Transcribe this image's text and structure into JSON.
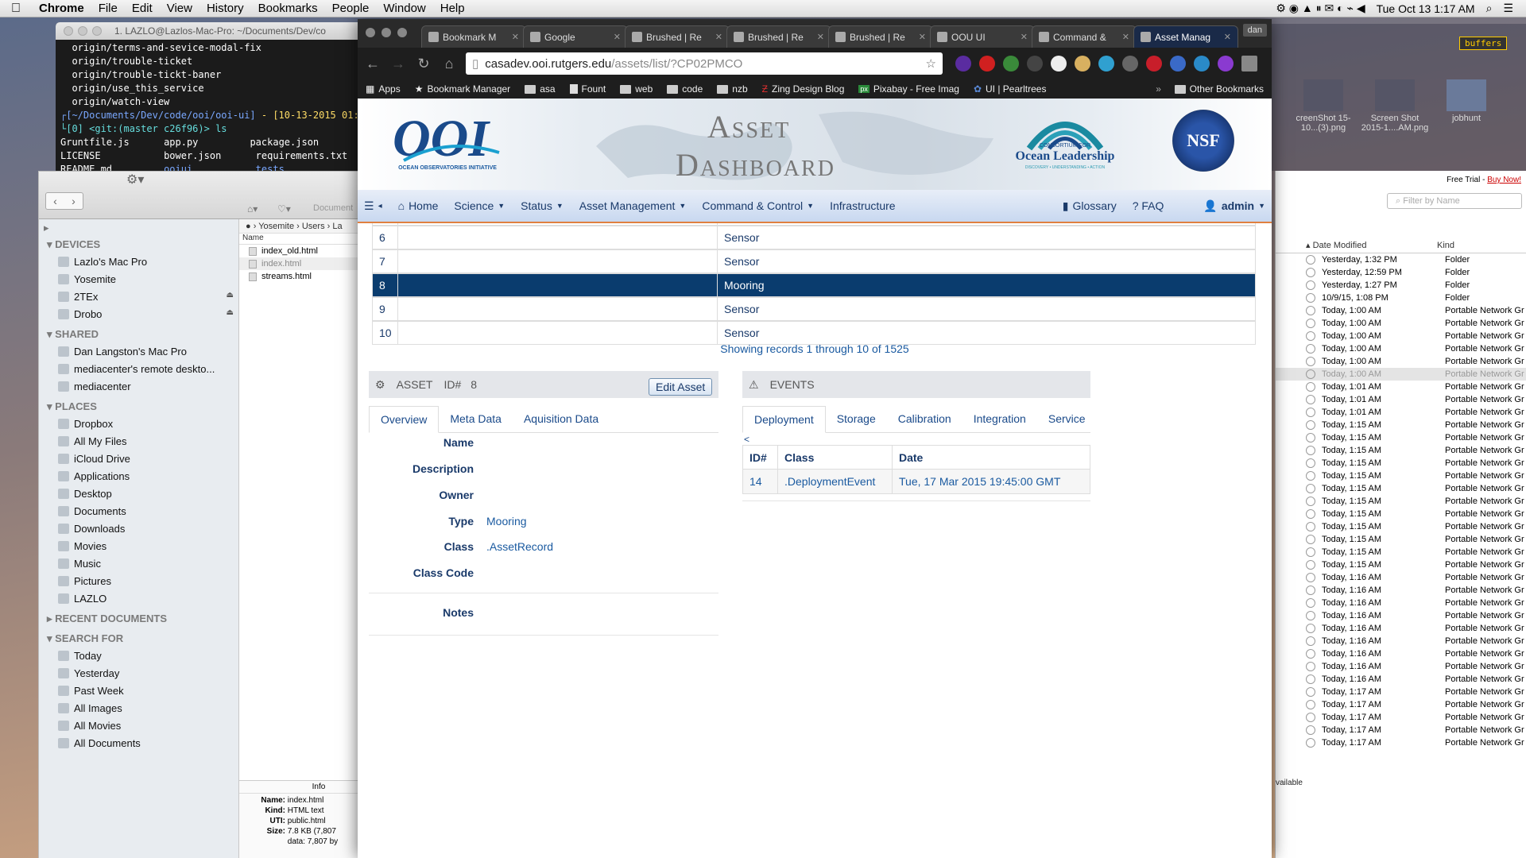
{
  "mac_menubar": {
    "apple": "",
    "items": [
      "Chrome",
      "File",
      "Edit",
      "View",
      "History",
      "Bookmarks",
      "People",
      "Window",
      "Help"
    ],
    "clock": "Tue Oct 13  1:17 AM"
  },
  "terminal": {
    "title": "1. LAZLO@Lazlos-Mac-Pro: ~/Documents/Dev/co",
    "lines": [
      "  origin/terms-and-sevice-modal-fix",
      "  origin/trouble-ticket",
      "  origin/trouble-tickt-baner",
      "  origin/use_this_service",
      "  origin/watch-view"
    ],
    "prompt_path": "┌[~/Documents/Dev/code/ooi/ooi-ui]",
    "prompt_date": " - [10-13-2015 01:1",
    "prompt2": "└[0] <git:(master c26f96)> ls",
    "ls_rows": [
      [
        "Gruntfile.js",
        "app.py",
        "package.json"
      ],
      [
        "LICENSE",
        "bower.json",
        "requirements.txt"
      ],
      [
        "README.md",
        "ooiui",
        "tests"
      ]
    ]
  },
  "finder": {
    "sections": [
      {
        "title": "DEVICES",
        "items": [
          "Lazlo's Mac Pro",
          "Yosemite",
          "2TEx",
          "Drobo"
        ]
      },
      {
        "title": "SHARED",
        "items": [
          "Dan Langston's Mac Pro",
          "mediacenter's remote deskto...",
          "mediacenter"
        ]
      },
      {
        "title": "PLACES",
        "items": [
          "Dropbox",
          "All My Files",
          "iCloud Drive",
          "Applications",
          "Desktop",
          "Documents",
          "Downloads",
          "Movies",
          "Music",
          "Pictures",
          "LAZLO"
        ]
      },
      {
        "title": "RECENT DOCUMENTS",
        "items": []
      },
      {
        "title": "SEARCH FOR",
        "items": [
          "Today",
          "Yesterday",
          "Past Week",
          "All Images",
          "All Movies",
          "All Documents"
        ]
      }
    ],
    "path": [
      "Yosemite",
      "Users",
      "La"
    ],
    "name_header": "Name",
    "files": [
      "index_old.html",
      "index.html",
      "streams.html"
    ],
    "info_header": "Info",
    "info": [
      {
        "k": "Name:",
        "v": "index.html"
      },
      {
        "k": "Kind:",
        "v": "HTML text"
      },
      {
        "k": "UTI:",
        "v": "public.html"
      },
      {
        "k": "Size:",
        "v": "7.8 KB (7,807"
      },
      {
        "k": "",
        "v": "data: 7,807 by"
      }
    ],
    "toolbar_label": "Document"
  },
  "finder2": {
    "trial": "Free Trial - ",
    "buy": "Buy Now!",
    "search_placeholder": "Filter by Name",
    "col_date": "Date Modified",
    "col_kind": "Kind",
    "rows": [
      [
        "Yesterday, 1:32 PM",
        "Folder"
      ],
      [
        "Yesterday, 12:59 PM",
        "Folder"
      ],
      [
        "Yesterday, 1:27 PM",
        "Folder"
      ],
      [
        "10/9/15, 1:08 PM",
        "Folder"
      ],
      [
        "Today, 1:00 AM",
        "Portable Network Gr"
      ],
      [
        "Today, 1:00 AM",
        "Portable Network Gr"
      ],
      [
        "Today, 1:00 AM",
        "Portable Network Gr"
      ],
      [
        "Today, 1:00 AM",
        "Portable Network Gr"
      ],
      [
        "Today, 1:00 AM",
        "Portable Network Gr"
      ],
      [
        "Today, 1:00 AM",
        "Portable Network Gr"
      ],
      [
        "Today, 1:01 AM",
        "Portable Network Gr"
      ],
      [
        "Today, 1:01 AM",
        "Portable Network Gr"
      ],
      [
        "Today, 1:01 AM",
        "Portable Network Gr"
      ],
      [
        "Today, 1:15 AM",
        "Portable Network Gr"
      ],
      [
        "Today, 1:15 AM",
        "Portable Network Gr"
      ],
      [
        "Today, 1:15 AM",
        "Portable Network Gr"
      ],
      [
        "Today, 1:15 AM",
        "Portable Network Gr"
      ],
      [
        "Today, 1:15 AM",
        "Portable Network Gr"
      ],
      [
        "Today, 1:15 AM",
        "Portable Network Gr"
      ],
      [
        "Today, 1:15 AM",
        "Portable Network Gr"
      ],
      [
        "Today, 1:15 AM",
        "Portable Network Gr"
      ],
      [
        "Today, 1:15 AM",
        "Portable Network Gr"
      ],
      [
        "Today, 1:15 AM",
        "Portable Network Gr"
      ],
      [
        "Today, 1:15 AM",
        "Portable Network Gr"
      ],
      [
        "Today, 1:15 AM",
        "Portable Network Gr"
      ],
      [
        "Today, 1:16 AM",
        "Portable Network Gr"
      ],
      [
        "Today, 1:16 AM",
        "Portable Network Gr"
      ],
      [
        "Today, 1:16 AM",
        "Portable Network Gr"
      ],
      [
        "Today, 1:16 AM",
        "Portable Network Gr"
      ],
      [
        "Today, 1:16 AM",
        "Portable Network Gr"
      ],
      [
        "Today, 1:16 AM",
        "Portable Network Gr"
      ],
      [
        "Today, 1:16 AM",
        "Portable Network Gr"
      ],
      [
        "Today, 1:16 AM",
        "Portable Network Gr"
      ],
      [
        "Today, 1:16 AM",
        "Portable Network Gr"
      ],
      [
        "Today, 1:17 AM",
        "Portable Network Gr"
      ],
      [
        "Today, 1:17 AM",
        "Portable Network Gr"
      ],
      [
        "Today, 1:17 AM",
        "Portable Network Gr"
      ],
      [
        "Today, 1:17 AM",
        "Portable Network Gr"
      ],
      [
        "Today, 1:17 AM",
        "Portable Network Gr"
      ]
    ],
    "available": "vailable"
  },
  "desktop_icons": [
    "creenShot\n15-10...(3).png",
    "Screen Shot\n2015-1....AM.png",
    "jobhunt"
  ],
  "buffers": "buffers",
  "chrome": {
    "tabs": [
      {
        "label": "Bookmark M",
        "active": false
      },
      {
        "label": "Google",
        "active": false
      },
      {
        "label": "Brushed | Re",
        "active": false
      },
      {
        "label": "Brushed | Re",
        "active": false
      },
      {
        "label": "Brushed | Re",
        "active": false
      },
      {
        "label": "OOU UI",
        "active": false
      },
      {
        "label": "Command &",
        "active": false
      },
      {
        "label": "Asset Manag",
        "active": true
      }
    ],
    "profile": "dan",
    "url_host": "casadev.ooi.rutgers.edu",
    "url_path": "/assets/list/?CP02PMCO",
    "bookmarks": [
      "Apps",
      "Bookmark Manager",
      "asa",
      "Fount",
      "web",
      "code",
      "nzb",
      "Zing Design Blog",
      "Pixabay - Free Imag",
      "UI | Pearltrees"
    ],
    "other_bookmarks": "Other Bookmarks"
  },
  "page": {
    "logo_ooi": "OOI",
    "logo_ooi_sub": "OCEAN OBSERVATORIES INITIATIVE",
    "title_line1": "Asset",
    "title_line2": "Dashboard",
    "ol_top": "CONSORTIUM FOR",
    "ol_main": "Ocean Leadership",
    "ol_sub": "DISCOVERY • UNDERSTANDING • ACTION",
    "nsf": "NSF",
    "nav": {
      "home": "Home",
      "science": "Science",
      "status": "Status",
      "asset_mgmt": "Asset Management",
      "command": "Command & Control",
      "infra": "Infrastructure",
      "glossary": "Glossary",
      "faq": "? FAQ",
      "user": "admin"
    },
    "table_rows": [
      {
        "id": "6",
        "name": "",
        "type": "Sensor",
        "selected": false
      },
      {
        "id": "7",
        "name": "",
        "type": "Sensor",
        "selected": false
      },
      {
        "id": "8",
        "name": "",
        "type": "Mooring",
        "selected": true
      },
      {
        "id": "9",
        "name": "",
        "type": "Sensor",
        "selected": false
      },
      {
        "id": "10",
        "name": "",
        "type": "Sensor",
        "selected": false
      }
    ],
    "showing": "Showing records 1 through 10 of 1525",
    "asset_panel": {
      "label": "ASSET",
      "id_label": "ID#",
      "id": "8",
      "edit": "Edit Asset",
      "tabs": [
        "Overview",
        "Meta Data",
        "Aquisition Data"
      ],
      "fields": [
        {
          "k": "Name",
          "v": ""
        },
        {
          "k": "Description",
          "v": ""
        },
        {
          "k": "Owner",
          "v": ""
        },
        {
          "k": "Type",
          "v": "Mooring"
        },
        {
          "k": "Class",
          "v": ".AssetRecord"
        },
        {
          "k": "Class Code",
          "v": ""
        },
        {
          "k": "Notes",
          "v": ""
        }
      ]
    },
    "events_panel": {
      "label": "EVENTS",
      "tabs": [
        "Deployment",
        "Storage",
        "Calibration",
        "Integration",
        "Service"
      ],
      "back": "<",
      "headers": [
        "ID#",
        "Class",
        "Date"
      ],
      "rows": [
        [
          "14",
          ".DeploymentEvent",
          "Tue, 17 Mar 2015 19:45:00 GMT"
        ]
      ]
    }
  }
}
